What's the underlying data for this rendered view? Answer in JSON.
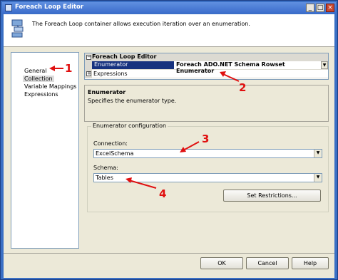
{
  "window": {
    "title": "Foreach Loop Editor",
    "controls": {
      "minimize": "_",
      "maximize": "□",
      "close": "×"
    }
  },
  "header": {
    "description": "The Foreach Loop container allows execution iteration over an enumeration.",
    "icon": "foreach-container-icon"
  },
  "nav": {
    "items": [
      {
        "label": "General",
        "selected": false
      },
      {
        "label": "Collection",
        "selected": true
      },
      {
        "label": "Variable Mappings",
        "selected": false
      },
      {
        "label": "Expressions",
        "selected": false
      }
    ]
  },
  "property_grid": {
    "category": "Foreach Loop Editor",
    "category_expander": "−",
    "rows": [
      {
        "name": "Enumerator",
        "value": "Foreach ADO.NET Schema Rowset Enumerator",
        "selected": true
      },
      {
        "name": "Expressions",
        "value": "",
        "expander": "+"
      }
    ]
  },
  "help": {
    "title": "Enumerator",
    "description": "Specifies the enumerator type."
  },
  "enumerator_config": {
    "legend": "Enumerator configuration",
    "connection_label": "Connection:",
    "connection_value": "ExcelSchema",
    "schema_label": "Schema:",
    "schema_value": "Tables",
    "set_restrictions_label": "Set Restrictions..."
  },
  "footer": {
    "ok": "OK",
    "cancel": "Cancel",
    "help": "Help"
  },
  "annotations": {
    "one": "1",
    "two": "2",
    "three": "3",
    "four": "4",
    "color": "#e01010"
  }
}
